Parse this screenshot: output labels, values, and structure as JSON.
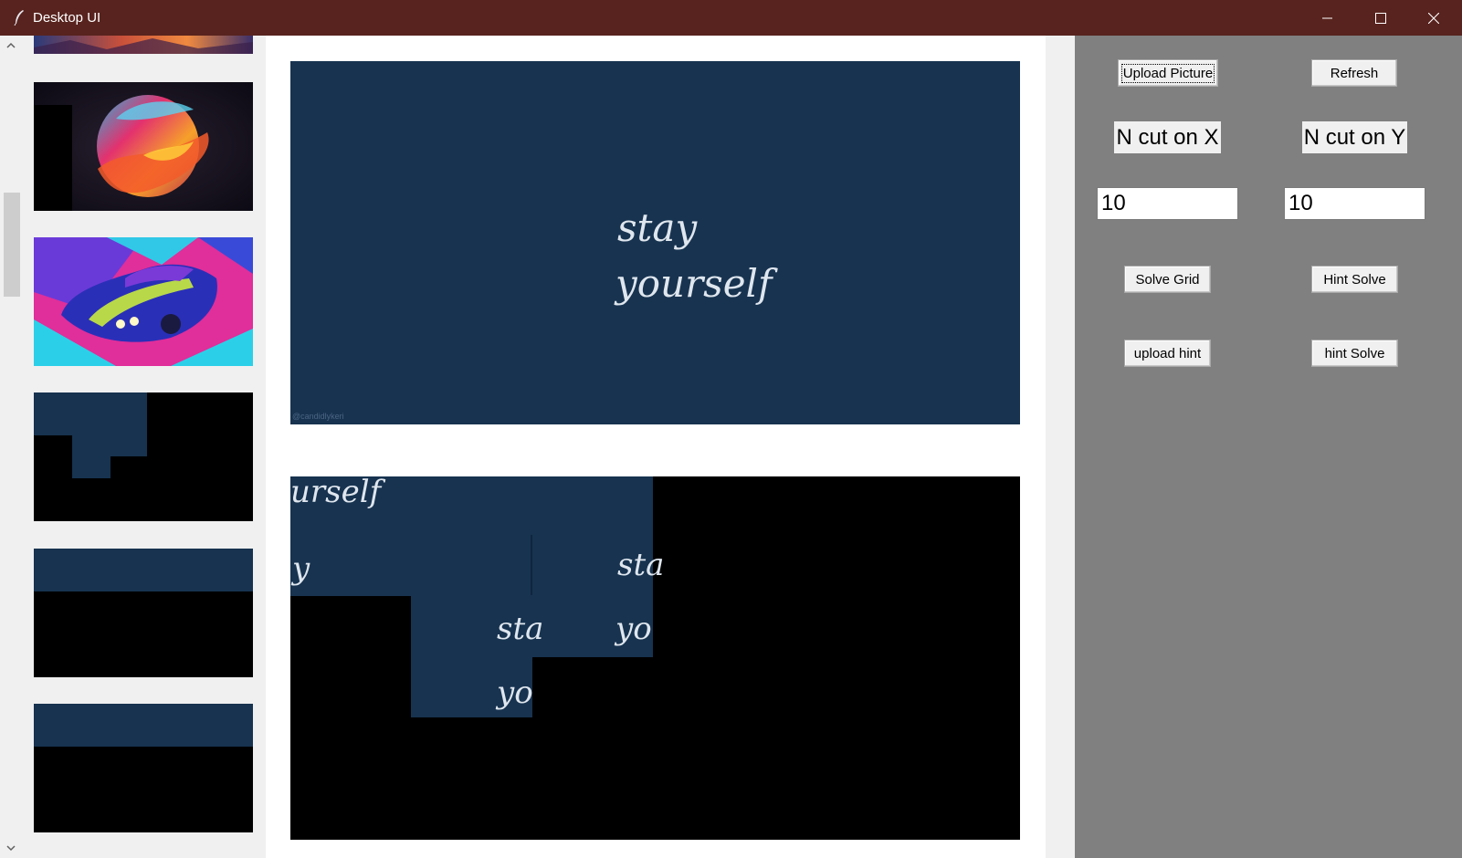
{
  "window": {
    "title": "Desktop UI",
    "minimize_icon": "minimize-icon",
    "maximize_icon": "maximize-icon",
    "close_icon": "close-icon",
    "titlebar_color": "#58231e"
  },
  "sidebar": {
    "thumbnails": [
      {
        "name": "thumbnail-mountain-sunset"
      },
      {
        "name": "thumbnail-colorful-planet"
      },
      {
        "name": "thumbnail-neon-car"
      },
      {
        "name": "thumbnail-partial-puzzle"
      },
      {
        "name": "thumbnail-puzzle-strip-1"
      },
      {
        "name": "thumbnail-puzzle-strip-2"
      }
    ]
  },
  "main": {
    "image_text_line1": "stay",
    "image_text_line2": "yourself",
    "watermark": "@candidlykeri",
    "puzzle_fragments": [
      "urself",
      "y",
      "sta",
      "yo",
      "sta",
      "yo"
    ]
  },
  "controls": {
    "upload_picture": "Upload Picture",
    "refresh": "Refresh",
    "n_cut_x_label": "N cut on X",
    "n_cut_y_label": "N cut on Y",
    "n_cut_x_value": "10",
    "n_cut_y_value": "10",
    "solve_grid": "Solve Grid",
    "hint_solve": "Hint Solve",
    "upload_hint": "upload hint",
    "hint_solve_lower": "hint Solve"
  },
  "colors": {
    "image_background": "#173350",
    "panel_background": "#808080"
  }
}
